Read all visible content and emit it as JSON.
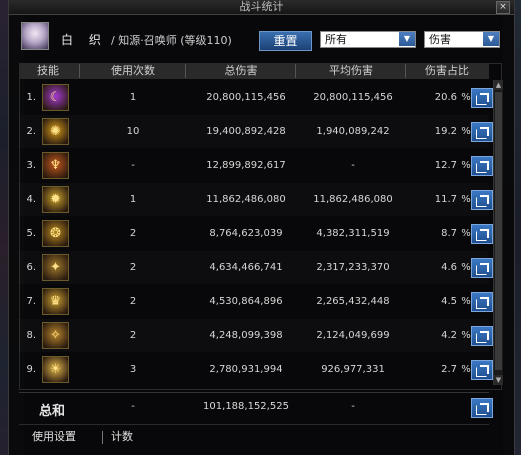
{
  "window": {
    "title": "战斗统计",
    "close_glyph": "×"
  },
  "player": {
    "name": "白 织",
    "class_text": "/ 知源·召唤师 (等级110)"
  },
  "toolbar": {
    "reset_label": "重置",
    "scope_select": {
      "value": "所有"
    },
    "metric_select": {
      "value": "伤害"
    }
  },
  "table": {
    "headers": {
      "skill": "技能",
      "uses": "使用次数",
      "total": "总伤害",
      "avg": "平均伤害",
      "pct": "伤害占比"
    },
    "rows": [
      {
        "rank": "1.",
        "uses": "1",
        "total": "20,800,115,456",
        "avg": "20,800,115,456",
        "pct": "20.6",
        "pct_sign": "%",
        "icon": "crescent-flame-icon",
        "glyph": "☾",
        "icon_color": "#a43bd1"
      },
      {
        "rank": "2.",
        "uses": "10",
        "total": "19,400,892,428",
        "avg": "1,940,089,242",
        "pct": "19.2",
        "pct_sign": "%",
        "icon": "golden-orb-icon",
        "glyph": "✺",
        "icon_color": "#d49a1a"
      },
      {
        "rank": "3.",
        "uses": "-",
        "total": "12,899,892,617",
        "avg": "-",
        "pct": "12.7",
        "pct_sign": "%",
        "icon": "demon-mask-icon",
        "glyph": "♆",
        "icon_color": "#c2581c"
      },
      {
        "rank": "4.",
        "uses": "1",
        "total": "11,862,486,080",
        "avg": "11,862,486,080",
        "pct": "11.7",
        "pct_sign": "%",
        "icon": "golden-beast-icon",
        "glyph": "✹",
        "icon_color": "#c9a22a"
      },
      {
        "rank": "5.",
        "uses": "2",
        "total": "8,764,623,039",
        "avg": "4,382,311,519",
        "pct": "8.7",
        "pct_sign": "%",
        "icon": "gold-swirl-icon",
        "glyph": "❂",
        "icon_color": "#b98a1f"
      },
      {
        "rank": "6.",
        "uses": "2",
        "total": "4,634,466,741",
        "avg": "2,317,233,370",
        "pct": "4.6",
        "pct_sign": "%",
        "icon": "summon-circle-icon",
        "glyph": "✦",
        "icon_color": "#a07a2a"
      },
      {
        "rank": "7.",
        "uses": "2",
        "total": "4,530,864,896",
        "avg": "2,265,432,448",
        "pct": "4.5",
        "pct_sign": "%",
        "icon": "crown-sigil-icon",
        "glyph": "♛",
        "icon_color": "#caa030"
      },
      {
        "rank": "8.",
        "uses": "2",
        "total": "4,248,099,398",
        "avg": "2,124,049,699",
        "pct": "4.2",
        "pct_sign": "%",
        "icon": "claw-strike-icon",
        "glyph": "✧",
        "icon_color": "#b7852c"
      },
      {
        "rank": "9.",
        "uses": "3",
        "total": "2,780,931,994",
        "avg": "926,977,331",
        "pct": "2.7",
        "pct_sign": "%",
        "icon": "sun-burst-icon",
        "glyph": "☀",
        "icon_color": "#e0b64a"
      }
    ],
    "total": {
      "label": "总和",
      "uses": "-",
      "total": "101,188,152,525",
      "avg": "-"
    }
  },
  "scrollbar": {
    "up_glyph": "▲",
    "down_glyph": "▼"
  },
  "footer": {
    "settings_label": "使用设置",
    "count_label": "计数"
  },
  "colors": {
    "accent_blue": "#2f66a8",
    "panel_bg": "#0b0b0d",
    "header_bg": "#2a2a2a"
  }
}
